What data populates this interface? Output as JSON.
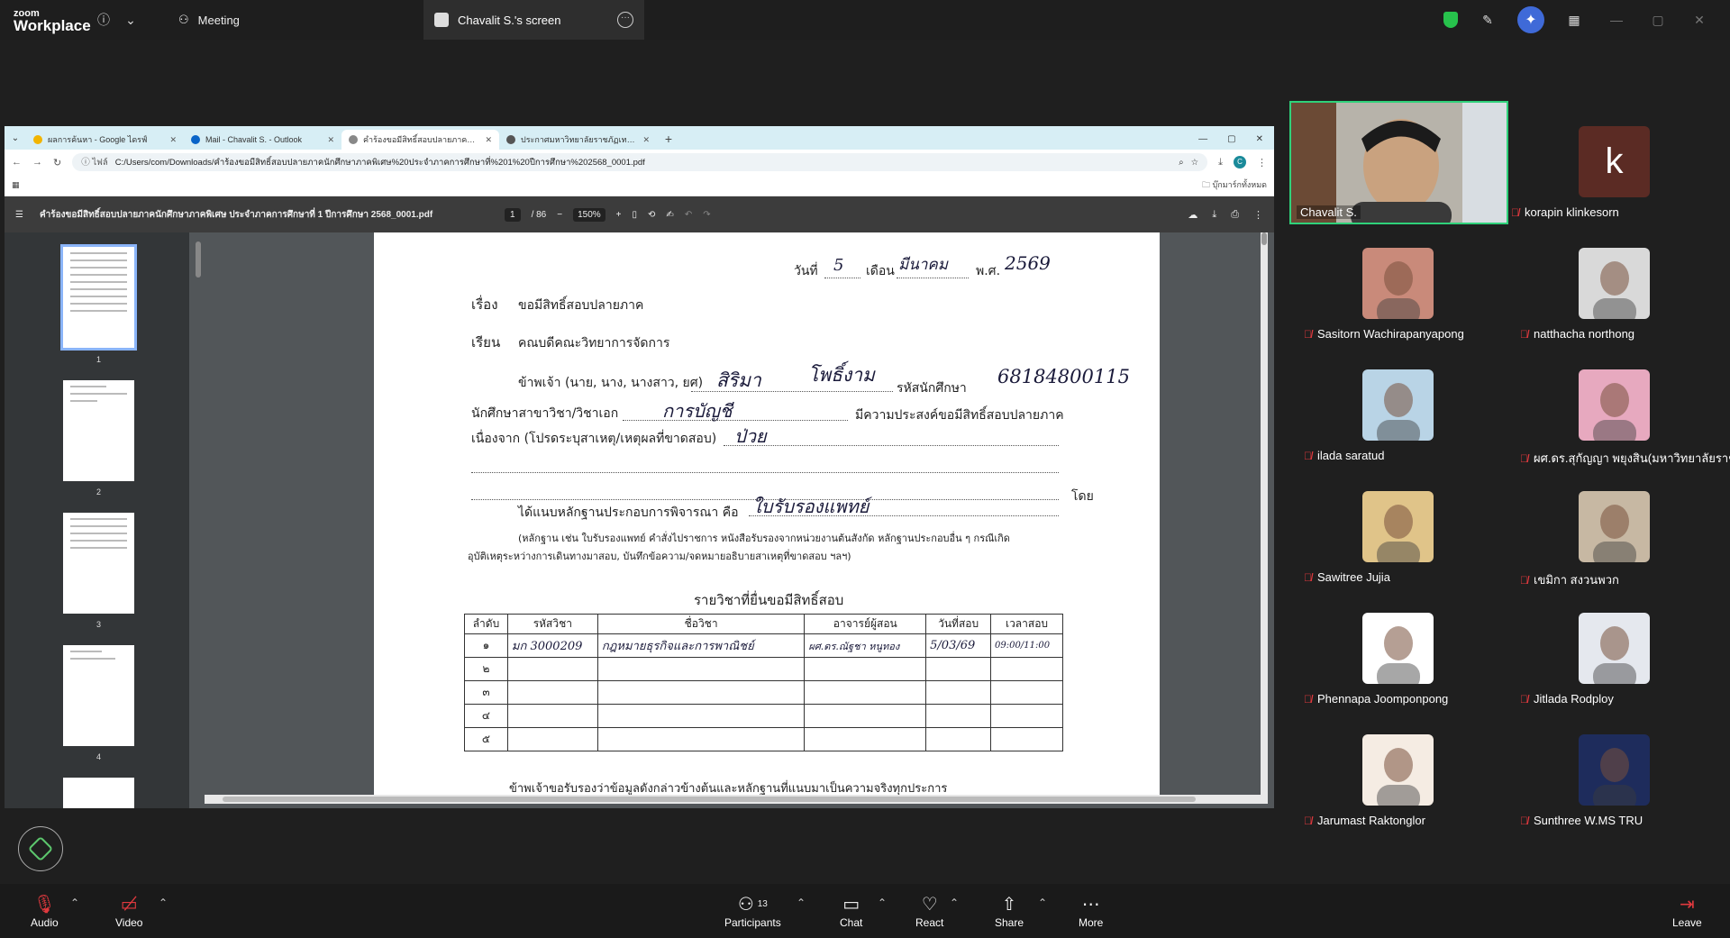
{
  "zoom": {
    "logo_top": "zoom",
    "logo_bottom": "Workplace",
    "meeting_label": "Meeting",
    "screen_tab_label": "Chavalit S.'s screen"
  },
  "browser": {
    "tabs": [
      {
        "label": "ผลการค้นหา - Google ไดรฟ์"
      },
      {
        "label": "Mail - Chavalit S. - Outlook"
      },
      {
        "label": "คำร้องขอมีสิทธิ์สอบปลายภาคนักศึกษ"
      },
      {
        "label": "ประกาศมหาวิทยาลัยราชภัฏเทพสตรี"
      }
    ],
    "site_label": "ไฟล์",
    "url": "C:/Users/com/Downloads/คำร้องขอมีสิทธิ์สอบปลายภาคนักศึกษาภาคพิเศษ%20ประจำภาคการศึกษาที่%201%20ปีการศึกษา%202568_0001.pdf",
    "profile_initial": "C",
    "bookmarks_label": "บุ๊กมาร์กทั้งหมด"
  },
  "pdf": {
    "title": "คำร้องขอมีสิทธิ์สอบปลายภาคนักศึกษาภาคพิเศษ ประจำภาคการศึกษาที่ 1 ปีการศึกษา 2568_0001.pdf",
    "page_current": "1",
    "page_total": "/ 86",
    "zoom": "150%",
    "thumbnails": [
      "1",
      "2",
      "3",
      "4"
    ]
  },
  "doc": {
    "date_day_label": "วันที่",
    "date_day": "5",
    "date_month_label": "เดือน",
    "date_month": "มีนาคม",
    "date_year_label": "พ.ศ.",
    "date_year": "2569",
    "subject_label": "เรื่อง",
    "subject": "ขอมีสิทธิ์สอบปลายภาค",
    "to_label": "เรียน",
    "to": "คณบดีคณะวิทยาการจัดการ",
    "applicant_label": "ข้าพเจ้า (นาย, นาง, นางสาว, ยศ)",
    "applicant_name": "สิริมา",
    "applicant_surname": "โพธิ์งาม",
    "student_id_label": "รหัสนักศึกษา",
    "student_id": "68184800115",
    "major_label": "นักศึกษาสาขาวิชา/วิชาเอก",
    "major": "การบัญชี",
    "intent": "มีความประสงค์ขอมีสิทธิ์สอบปลายภาค",
    "reason_label": "เนื่องจาก (โปรดระบุสาเหตุ/เหตุผลที่ขาดสอบ)",
    "reason": "ป่วย",
    "by_label": "โดย",
    "evidence_label": "ได้แนบหลักฐานประกอบการพิจารณา คือ",
    "evidence": "ใบรับรองแพทย์",
    "evidence_note_1": "(หลักฐาน เช่น ใบรับรองแพทย์ คำสั่งไปราชการ หนังสือรับรองจากหน่วยงานต้นสังกัด หลักฐานประกอบอื่น ๆ กรณีเกิด",
    "evidence_note_2": "อุบัติเหตุระหว่างการเดินทางมาสอบ, บันทึกข้อความ/จดหมายอธิบายสาเหตุที่ขาดสอบ ฯลฯ)",
    "table_title": "รายวิชาที่ยื่นขอมีสิทธิ์สอบ",
    "table_headers": [
      "ลำดับ",
      "รหัสวิชา",
      "ชื่อวิชา",
      "อาจารย์ผู้สอน",
      "วันที่สอบ",
      "เวลาสอบ"
    ],
    "table_rows": [
      [
        "๑",
        "มก 3000209",
        "กฎหมายธุรกิจและการพาณิชย์",
        "ผศ.ดร.ณัฐชา หนูทอง",
        "5/03/69",
        "09:00/11:00"
      ],
      [
        "๒",
        "",
        "",
        "",
        "",
        ""
      ],
      [
        "๓",
        "",
        "",
        "",
        "",
        ""
      ],
      [
        "๔",
        "",
        "",
        "",
        "",
        ""
      ],
      [
        "๕",
        "",
        "",
        "",
        "",
        ""
      ]
    ],
    "bottom_text": "ข้าพเจ้าขอรับรองว่าข้อมูลดังกล่าวข้างต้นและหลักฐานที่แนบมาเป็นความจริงทุกประการ"
  },
  "host": {
    "name": "Chavalit S."
  },
  "participants": [
    {
      "name": "korapin klinkesorn",
      "initial": "k",
      "color": "#5b2b24"
    },
    {
      "name": "Sasitorn Wachirapanyapong",
      "color": "#c98a7a"
    },
    {
      "name": "natthacha northong",
      "color": "#d9d9d9"
    },
    {
      "name": "ilada saratud",
      "color": "#b9d4e6"
    },
    {
      "name": "ผศ.ดร.สุกัญญา พยุงสิน(มหาวิทยาลัยราช...",
      "color": "#e7a9bf"
    },
    {
      "name": "Sawitree Jujia",
      "color": "#e0c489"
    },
    {
      "name": "เขมิกา สงวนพวก",
      "color": "#c7b8a3"
    },
    {
      "name": "Phennapa Joomponpong",
      "color": "#ffffff"
    },
    {
      "name": "Jitlada Rodploy",
      "color": "#e5e8ee"
    },
    {
      "name": "Jarumast Raktonglor",
      "color": "#f5ece3"
    },
    {
      "name": "Sunthree W.MS TRU",
      "color": "#1e2c5c"
    }
  ],
  "bottom_bar": {
    "audio": "Audio",
    "video": "Video",
    "participants": "Participants",
    "participants_count": "13",
    "chat": "Chat",
    "react": "React",
    "share": "Share",
    "more": "More",
    "leave": "Leave"
  },
  "colors": {
    "zoom_bg": "#1e1e1e",
    "active_speaker": "#2fd17a",
    "muted": "#e0393e",
    "chrome_tabstrip": "#d7eef5",
    "pdf_toolbar": "#3c3c3c"
  }
}
